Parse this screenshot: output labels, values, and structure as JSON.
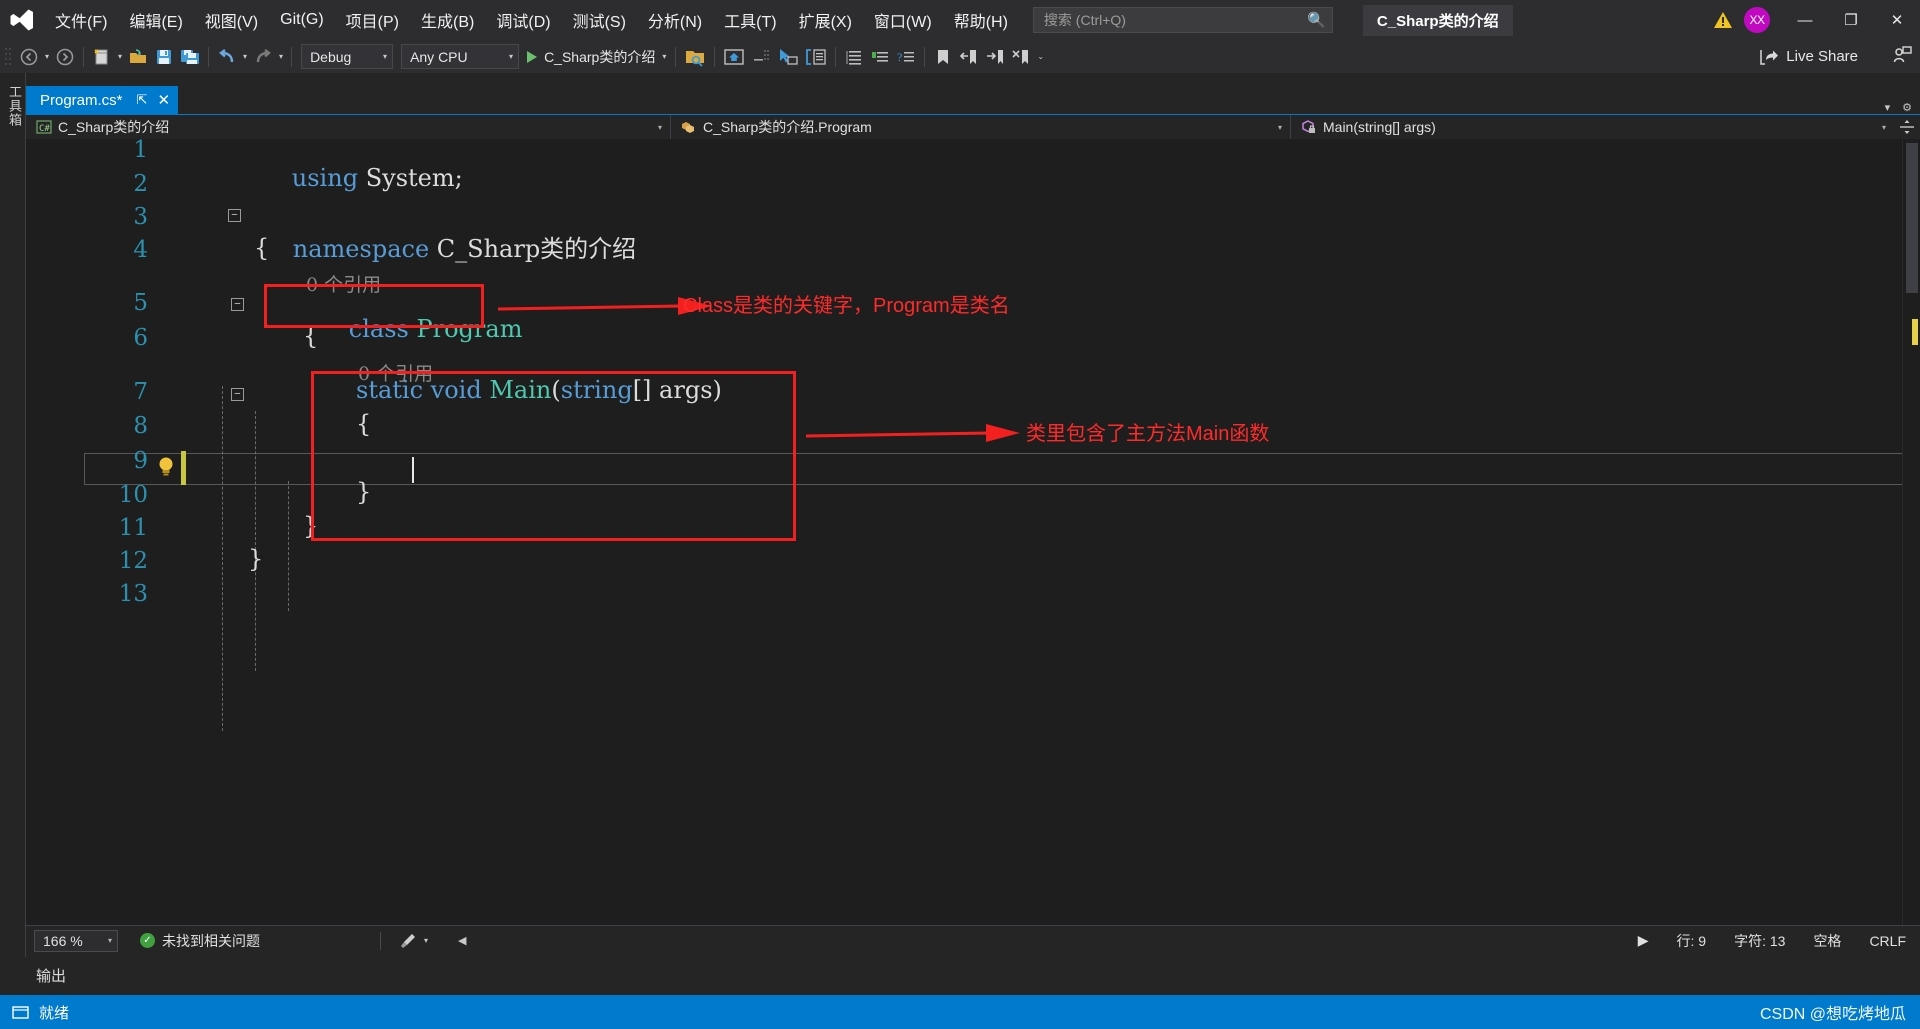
{
  "window": {
    "solution_name": "C_Sharp类的介绍",
    "avatar_initials": "XX",
    "minimize": "—",
    "maximize": "❐",
    "close": "✕"
  },
  "menu": {
    "items": [
      {
        "label": "文件(F)",
        "key": "F"
      },
      {
        "label": "编辑(E)",
        "key": "E"
      },
      {
        "label": "视图(V)",
        "key": "V"
      },
      {
        "label": "Git(G)",
        "key": "G"
      },
      {
        "label": "项目(P)",
        "key": "P"
      },
      {
        "label": "生成(B)",
        "key": "B"
      },
      {
        "label": "调试(D)",
        "key": "D"
      },
      {
        "label": "测试(S)",
        "key": "S"
      },
      {
        "label": "分析(N)",
        "key": "N"
      },
      {
        "label": "工具(T)",
        "key": "T"
      },
      {
        "label": "扩展(X)",
        "key": "X"
      },
      {
        "label": "窗口(W)",
        "key": "W"
      },
      {
        "label": "帮助(H)",
        "key": "H"
      }
    ]
  },
  "search": {
    "placeholder": "搜索 (Ctrl+Q)",
    "value": ""
  },
  "toolbar": {
    "configuration": "Debug",
    "platform": "Any CPU",
    "run_target": "C_Sharp类的介绍",
    "live_share": "Live Share"
  },
  "tabs": [
    {
      "label": "Program.cs*",
      "pin": "⇱",
      "close": "✕",
      "active": true
    }
  ],
  "navbar": {
    "project": "C_Sharp类的介绍",
    "type": "C_Sharp类的介绍.Program",
    "member": "Main(string[] args)"
  },
  "sidebar": {
    "vertical_label": "工具箱"
  },
  "editor": {
    "line_numbers": [
      "1",
      "2",
      "3",
      "4",
      "5",
      "6",
      "7",
      "8",
      "9",
      "10",
      "11",
      "12",
      "13"
    ],
    "lines": [
      {
        "n": 1,
        "indent": 1,
        "tokens": [
          {
            "t": "using",
            "c": "k"
          },
          {
            "t": " System;",
            "c": "p"
          }
        ]
      },
      {
        "n": 2,
        "indent": 1,
        "tokens": []
      },
      {
        "n": 3,
        "indent": 0,
        "tokens": [
          {
            "t": "namespace",
            "c": "k"
          },
          {
            "t": " C_Sharp类的介绍",
            "c": "p"
          }
        ]
      },
      {
        "n": 4,
        "indent": 1,
        "tokens": [
          {
            "t": "{",
            "c": "p"
          }
        ]
      },
      {
        "n": 5,
        "indent": 2,
        "tokens": [
          {
            "t": "class",
            "c": "k"
          },
          {
            "t": " ",
            "c": "p"
          },
          {
            "t": "Program",
            "c": "t"
          }
        ]
      },
      {
        "n": 6,
        "indent": 2,
        "tokens": [
          {
            "t": "{",
            "c": "p"
          }
        ]
      },
      {
        "n": 7,
        "indent": 3,
        "tokens": [
          {
            "t": "static",
            "c": "k"
          },
          {
            "t": " ",
            "c": "p"
          },
          {
            "t": "void",
            "c": "k"
          },
          {
            "t": " ",
            "c": "p"
          },
          {
            "t": "Main",
            "c": "t"
          },
          {
            "t": "(",
            "c": "p"
          },
          {
            "t": "string",
            "c": "k"
          },
          {
            "t": "[] args)",
            "c": "p"
          }
        ]
      },
      {
        "n": 8,
        "indent": 3,
        "tokens": [
          {
            "t": "{",
            "c": "p"
          }
        ]
      },
      {
        "n": 9,
        "indent": 4,
        "tokens": []
      },
      {
        "n": 10,
        "indent": 3,
        "tokens": [
          {
            "t": "}",
            "c": "p"
          }
        ]
      },
      {
        "n": 11,
        "indent": 2,
        "tokens": [
          {
            "t": "}",
            "c": "p"
          }
        ]
      },
      {
        "n": 12,
        "indent": 1,
        "tokens": [
          {
            "t": "}",
            "c": "p"
          }
        ]
      },
      {
        "n": 13,
        "indent": 0,
        "tokens": []
      }
    ],
    "code_text": {
      "l1": "using System;",
      "l3_kw": "namespace",
      "l3_name": " C_Sharp类的介绍",
      "l4": "{",
      "l5_kw": "class",
      "l5_name": "Program",
      "l6": "{",
      "l7_a": "static",
      "l7_b": "void",
      "l7_c": "Main",
      "l7_d": "(",
      "l7_e": "string",
      "l7_f": "[] args)",
      "l8": "{",
      "l10": "}",
      "l11": "}",
      "l12": "}"
    },
    "codelens": [
      {
        "text": "0 个引用",
        "for_line": 5
      },
      {
        "text": "0 个引用",
        "for_line": 7
      }
    ]
  },
  "annotations": [
    {
      "text": "Class是类的关键字，Program是类名",
      "color": "#ff2a2a"
    },
    {
      "text": "类里包含了主方法Main函数",
      "color": "#ff2a2a"
    }
  ],
  "status": {
    "zoom": "166 %",
    "problems": "未找到相关问题",
    "line": "行: 9",
    "column": "字符: 13",
    "spaces": "空格",
    "eol": "CRLF",
    "output_label": "输出",
    "ready": "就绪",
    "watermark": "CSDN @想吃烤地瓜"
  },
  "colors": {
    "accent": "#007acc",
    "keyword": "#569cd6",
    "type": "#4ec9b0",
    "linenum": "#2b91af",
    "annotation_red": "#ff2a2a",
    "avatar": "#c209c2",
    "editor_bg": "#1e1e1e",
    "chrome_bg": "#2d2d30"
  }
}
